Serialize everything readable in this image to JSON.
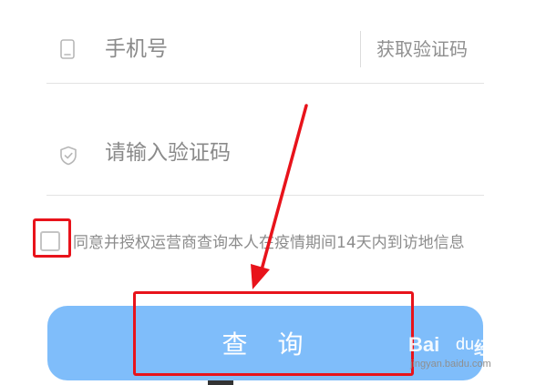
{
  "form": {
    "phone_placeholder": "手机号",
    "get_code_label": "获取验证码",
    "code_placeholder": "请输入验证码",
    "agreement_text": "同意并授权运营商查询本人在疫情期间14天内到访地信息",
    "agreement_checked": false,
    "submit_label": "查 询"
  },
  "colors": {
    "button_bg": "#7fbdfa",
    "highlight": "#e8131b",
    "placeholder": "#8a8a8a",
    "divider": "#e3e3e3"
  },
  "icons": {
    "phone": "phone-icon",
    "shield": "shield-check-icon"
  },
  "watermark": {
    "logo_text": "Bai",
    "paw_glyph": "du",
    "brand": "经验",
    "url": "jingyan.baidu.com"
  }
}
